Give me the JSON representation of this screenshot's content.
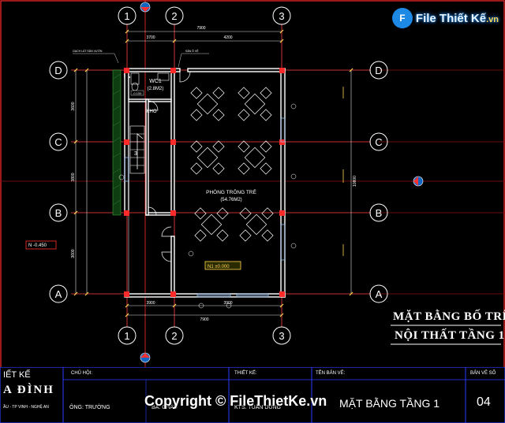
{
  "watermark": {
    "badge": "F",
    "text": "File Thiết Kế",
    "ext": ".vn"
  },
  "grid": {
    "cols": [
      "1",
      "2",
      "3"
    ],
    "rows": [
      "D",
      "C",
      "B",
      "A"
    ]
  },
  "dimensions": {
    "top_total": "7900",
    "top_a": "3700",
    "top_b": "4200",
    "bottom_a": "3900",
    "bottom_b": "3900",
    "bottom_total": "7900",
    "left_1": "3600",
    "left_2": "3800",
    "left_3": "3600",
    "right_total": "10800"
  },
  "rooms": {
    "wc_name": "WC1",
    "wc_area": "(2.8M2)",
    "store": "KHO",
    "main_name": "PHÒNG TRÔNG TRẺ",
    "main_area": "(54.76M2)",
    "stair_no": "3"
  },
  "levels": {
    "outside": "N -0.450",
    "floor": "N1 ±0.000"
  },
  "annotations": {
    "top_left_note": "GẠCH LÁT SÂN VƯỜN",
    "top_right_note": "SÀN Ô VỆ",
    "wc_level": "-0.100"
  },
  "drawing_title": {
    "line1": "MẶT BẰNG BỐ TRÍ",
    "line2": "NỘI THẤT TẦNG 1"
  },
  "title_block": {
    "design_label": "IẾT KẾ",
    "design_name": "A ĐÌNH",
    "address": "ẦU - TP VINH - NGHỆ AN",
    "owner_label": "CHỦ HỘI:",
    "owner_name": "ÔNG: TRƯỜNG",
    "owner_wife": "BÀ: CHÂU",
    "designer_label": "THIẾT KẾ:",
    "designer_name": "KTS. TUẤN DŨNG",
    "sheet_name_label": "TÊN BẢN VẼ:",
    "sheet_name": "MẶT BẰNG TẦNG 1",
    "sheet_no_label": "BẢN VẼ SỐ",
    "sheet_no": "04"
  },
  "copyright": "Copyright © FileThietKe.vn"
}
